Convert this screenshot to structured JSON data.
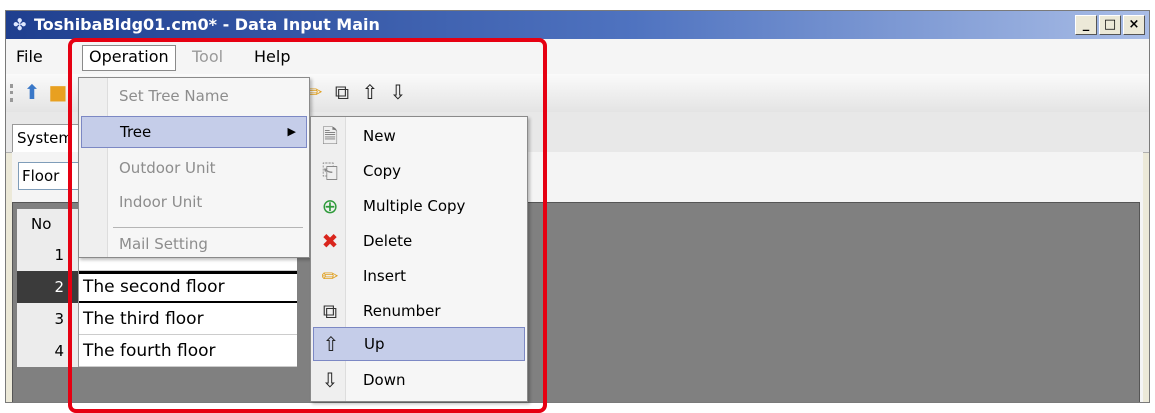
{
  "window": {
    "title": "ToshibaBldg01.cm0* - Data Input Main",
    "title_icon": "✤",
    "controls": {
      "minimize": "_",
      "maximize": "□",
      "close": "×"
    }
  },
  "menubar": {
    "items": [
      {
        "label": "File",
        "state": "normal"
      },
      {
        "label": "Operation",
        "state": "open"
      },
      {
        "label": "Tool",
        "state": "disabled"
      },
      {
        "label": "Help",
        "state": "normal"
      }
    ]
  },
  "toolbar": {
    "icons": [
      "upload-icon",
      "folder-icon",
      "pencil-icon",
      "renumber-icon",
      "up-arrow-icon",
      "down-arrow-icon"
    ],
    "glyphs": {
      "upload": "⬆",
      "folder": "■",
      "pencil": "✏",
      "renumber": "⧉",
      "up": "⇧",
      "down": "⇩"
    }
  },
  "tabs": {
    "active": "System"
  },
  "floor_select": {
    "value": "Floor"
  },
  "grid": {
    "header_no": "No",
    "rows": [
      {
        "no": "1",
        "name": ""
      },
      {
        "no": "2",
        "name": "The second floor",
        "selected": true
      },
      {
        "no": "3",
        "name": "The third floor"
      },
      {
        "no": "4",
        "name": "The fourth floor"
      }
    ]
  },
  "operation_menu": {
    "items": [
      {
        "label": "Set Tree Name",
        "state": "disabled"
      },
      {
        "label": "Tree",
        "state": "hover",
        "submenu_arrow": "▶"
      },
      {
        "label": "Outdoor Unit",
        "state": "disabled"
      },
      {
        "label": "Indoor Unit",
        "state": "disabled"
      },
      {
        "label": "Mail Setting",
        "state": "disabled"
      }
    ]
  },
  "tree_submenu": {
    "items": [
      {
        "label": "New",
        "icon": "new-document-icon",
        "glyph": "🗎"
      },
      {
        "label": "Copy",
        "icon": "copy-icon",
        "glyph": "⎗"
      },
      {
        "label": "Multiple Copy",
        "icon": "multiple-copy-icon",
        "glyph": "⊕"
      },
      {
        "label": "Delete",
        "icon": "delete-icon",
        "glyph": "✖"
      },
      {
        "label": "Insert",
        "icon": "insert-pencil-icon",
        "glyph": "✏"
      },
      {
        "label": "Renumber",
        "icon": "renumber-icon",
        "glyph": "⧉"
      },
      {
        "label": "Up",
        "icon": "up-arrow-icon",
        "glyph": "⇧",
        "hover": true
      },
      {
        "label": "Down",
        "icon": "down-arrow-icon",
        "glyph": "⇩"
      }
    ]
  },
  "colors": {
    "highlight_border": "#e60012",
    "title_bar": "#2a4a9a",
    "menu_hover": "#c5cde9",
    "delete_icon": "#d9251d"
  }
}
